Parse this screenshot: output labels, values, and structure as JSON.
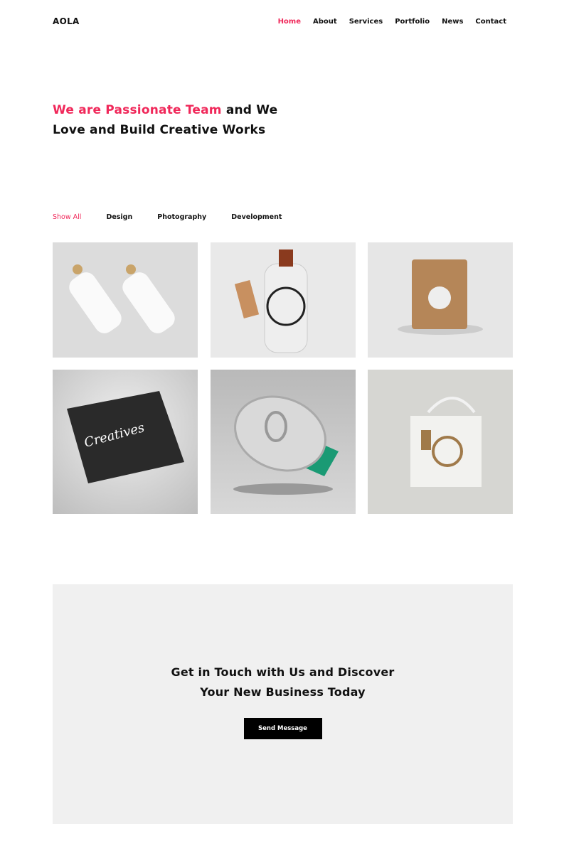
{
  "header": {
    "logo": "AOLA",
    "nav": [
      {
        "label": "Home",
        "active": true
      },
      {
        "label": "About"
      },
      {
        "label": "Services"
      },
      {
        "label": "Portfolio"
      },
      {
        "label": "News"
      },
      {
        "label": "Contact"
      }
    ]
  },
  "hero": {
    "accent": "We are Passionate Team",
    "rest_line1": " and We",
    "line2": "Love and Build Creative Works"
  },
  "filters": [
    "Show All",
    "Design",
    "Photography",
    "Development"
  ],
  "portfolio": [
    {
      "subject": "milk bottles"
    },
    {
      "subject": "wrapped bottle"
    },
    {
      "subject": "paper bag"
    },
    {
      "subject": "tri-fold brochure"
    },
    {
      "subject": "tin can"
    },
    {
      "subject": "tote bag"
    }
  ],
  "cta": {
    "line1": "Get in Touch with Us and Discover",
    "line2": "Your New Business Today",
    "button": "Send Message"
  },
  "colors": {
    "accent": "#f0285a",
    "cta_bg": "#f0f0f0",
    "button_bg": "#000000"
  }
}
